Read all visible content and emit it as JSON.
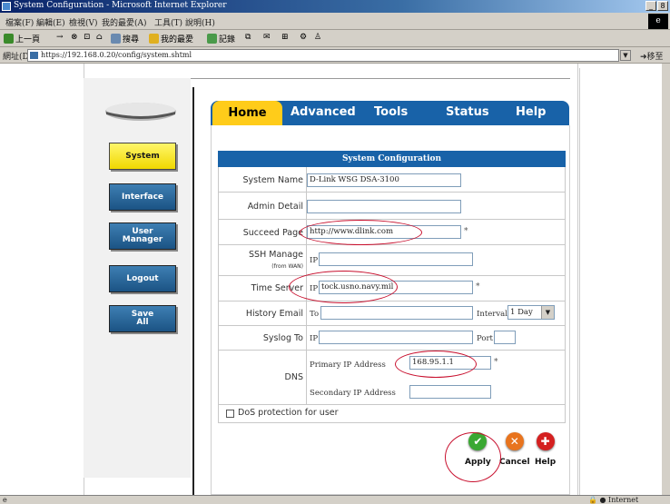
{
  "window": {
    "title": "System Configuration - Microsoft Internet Explorer",
    "controls": [
      "_",
      "8",
      "×"
    ]
  },
  "menubar": {
    "items": [
      "檔案(F)",
      "編輯(E)",
      "檢視(V)",
      "我的最愛(A)",
      "工具(T)",
      "說明(H)"
    ]
  },
  "toolbar": {
    "items": [
      "上一頁",
      "→",
      "⊗",
      "⊡",
      "⌂",
      "搜尋",
      "我的最愛",
      "記錄",
      "⧉",
      "✉",
      "⊞",
      "⚙",
      "♙"
    ]
  },
  "address": {
    "label": "網址(D)",
    "url": "https://192.168.0.20/config/system.shtml",
    "go_label": "移至"
  },
  "status": {
    "left": "e",
    "zone": "Internet"
  },
  "sidebar": {
    "items": [
      {
        "label": "System",
        "active": true
      },
      {
        "label": "Interface",
        "active": false
      },
      {
        "label": "User\nManager",
        "active": false
      },
      {
        "label": "Logout",
        "active": false
      },
      {
        "label": "Save\nAll",
        "active": false
      }
    ]
  },
  "tabs": [
    "Home",
    "Advanced",
    "Tools",
    "Status",
    "Help"
  ],
  "form": {
    "header": "System Configuration",
    "system_name": {
      "label": "System Name",
      "value": "D-Link WSG DSA-3100"
    },
    "admin_detail": {
      "label": "Admin Detail",
      "value": ""
    },
    "succeed_page": {
      "label": "Succeed Page",
      "value": "http://www.dlink.com",
      "required": "*"
    },
    "ssh_manage": {
      "label": "SSH Manage",
      "sublabel": "(from WAN)",
      "ip_label": "IP",
      "value": ""
    },
    "time_server": {
      "label": "Time Server",
      "ip_label": "IP",
      "value": "tock.usno.navy.mil",
      "required": "*"
    },
    "history_email": {
      "label": "History Email",
      "to_label": "To",
      "value": "",
      "interval_label": "Interval",
      "interval_value": "1 Day"
    },
    "syslog_to": {
      "label": "Syslog To",
      "ip_label": "IP",
      "value": "",
      "port_label": "Port",
      "port_value": ""
    },
    "dns": {
      "label": "DNS",
      "primary_label": "Primary IP Address",
      "primary_value": "168.95.1.1",
      "secondary_label": "Secondary IP Address",
      "secondary_value": "",
      "required": "*"
    },
    "dos": {
      "label": "DoS protection for user",
      "checked": false
    }
  },
  "actions": {
    "apply": "Apply",
    "cancel": "Cancel",
    "help": "Help"
  },
  "colors": {
    "tab_blue": "#1862a8",
    "tab_active": "#ffcc1a",
    "nav_active": "#f7e43a",
    "annotation_red": "#c8102e",
    "apply_green": "#3aa832",
    "cancel_orange": "#e8741e",
    "help_red": "#d42020"
  }
}
